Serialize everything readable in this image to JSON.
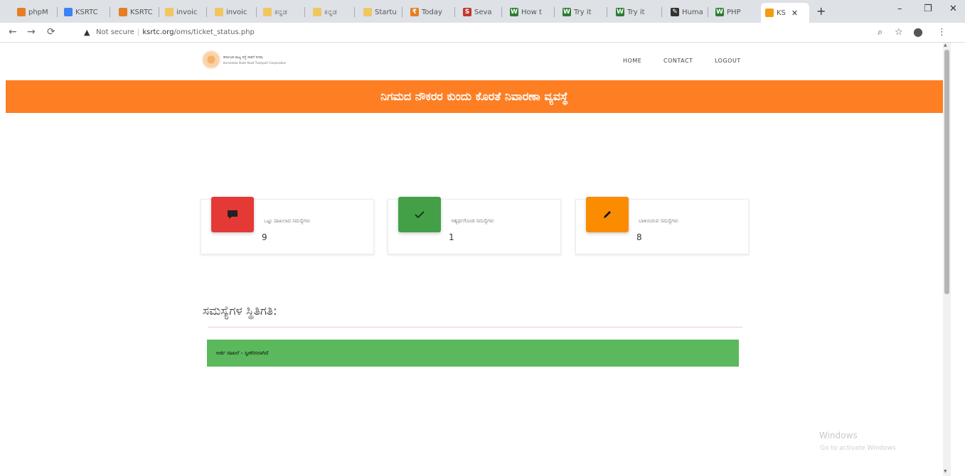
{
  "browser": {
    "tabs": [
      {
        "label": "phpM",
        "icon": "phpmyadmin-icon",
        "color": "#e67e22"
      },
      {
        "label": "KSRTC",
        "icon": "ksrtc-icon",
        "color": "#3b82f6"
      },
      {
        "label": "KSRTC",
        "icon": "ksrtc-icon",
        "color": "#e67e22"
      },
      {
        "label": "invoic",
        "icon": "invoice-icon",
        "color": "#f0c75e"
      },
      {
        "label": "invoic",
        "icon": "invoice-icon",
        "color": "#f0c75e"
      },
      {
        "label": "ಕನ್ನಡ",
        "icon": "document-icon",
        "color": "#f0c75e"
      },
      {
        "label": "ಕನ್ನಡ",
        "icon": "document-icon",
        "color": "#f0c75e"
      },
      {
        "label": "Startu",
        "icon": "document-icon",
        "color": "#f0c75e"
      },
      {
        "label": "Today",
        "icon": "rupee-icon",
        "color": "#e67e22"
      },
      {
        "label": "Seva",
        "icon": "seva-icon",
        "color": "#c0392b"
      },
      {
        "label": "How t",
        "icon": "w-icon",
        "color": "#2e7d32"
      },
      {
        "label": "Try it",
        "icon": "w-icon",
        "color": "#2e7d32"
      },
      {
        "label": "Try it",
        "icon": "w-icon",
        "color": "#2e7d32"
      },
      {
        "label": "Huma",
        "icon": "pen-icon",
        "color": "#333333"
      },
      {
        "label": "PHP",
        "icon": "w-icon",
        "color": "#2e7d32"
      },
      {
        "label": "KS",
        "icon": "ksrtc-icon",
        "color": "#f39c12"
      }
    ],
    "new_tab": "+",
    "window": {
      "minimize": "–",
      "maximize": "❐",
      "close": "✕"
    },
    "address": {
      "security": "Not secure",
      "host": "ksrtc.org",
      "path": "/oms/ticket_status.php"
    }
  },
  "site": {
    "logo": {
      "line1": "ಕರ್ನಾಟಕ ರಾಜ್ಯ ರಸ್ತೆ ಸಾರಿಗೆ ನಿಗಮ",
      "line2": "Karnataka State Road Transport Corporation"
    },
    "nav": {
      "home": "HOME",
      "contact": "CONTACT",
      "logout": "LOGOUT"
    },
    "banner": "ನಿಗಮದ ನೌಕರರ ಕುಂದು ಕೊರತೆ ನಿವಾರಣಾ ವ್ಯವಸ್ಥೆ",
    "cards": [
      {
        "label": "ಒಟ್ಟು ದಾಖಲಾದ ಸಮಸ್ಯೆಗಳು",
        "count": "9",
        "icon": "comment-icon",
        "color": "#e53935"
      },
      {
        "label": "ಇತ್ಯರ್ಥಗೊಂಡ ಸಮಸ್ಯೆಗಳು",
        "count": "1",
        "icon": "check-icon",
        "color": "#43a047"
      },
      {
        "label": "ಬಾಕಿಯಿರುವ ಸಮಸ್ಯೆಗಳು",
        "count": "8",
        "icon": "pencil-icon",
        "color": "#fb8c00"
      }
    ],
    "status_title": "ಸಮಸ್ಯೆಗಳ ಸ್ಥಿತಿಗತಿ:",
    "status_bar": "ಅರ್ಜಿ ದಾಖಲೆ - ಸ್ವೀಕರಿಸಲಾಗಿದೆ"
  },
  "watermark": {
    "line1": "Windows",
    "line2": "Go to activate Windows"
  }
}
